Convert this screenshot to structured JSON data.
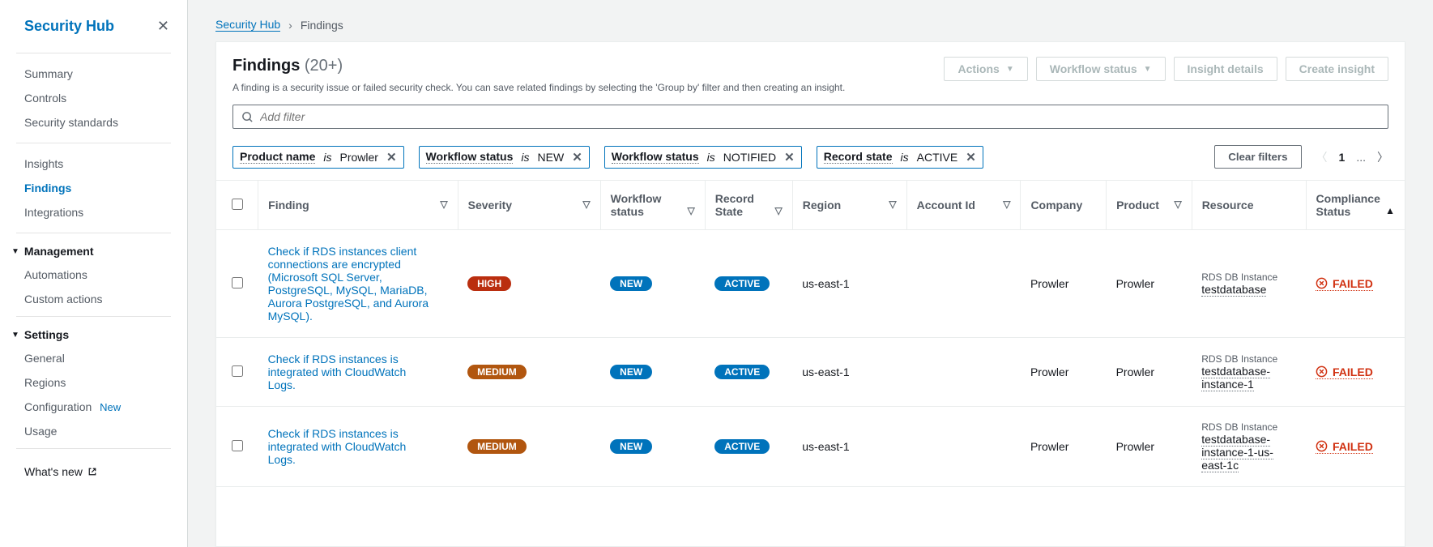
{
  "sidebar": {
    "title": "Security Hub",
    "sections": {
      "top": [
        "Summary",
        "Controls",
        "Security standards"
      ],
      "mid": [
        "Insights",
        "Findings",
        "Integrations"
      ],
      "management_label": "Management",
      "management": [
        "Automations",
        "Custom actions"
      ],
      "settings_label": "Settings",
      "settings": [
        "General",
        "Regions",
        "Configuration",
        "Usage"
      ]
    },
    "config_new": "New",
    "whats_new": "What's new"
  },
  "breadcrumb": {
    "root": "Security Hub",
    "current": "Findings"
  },
  "header": {
    "title": "Findings",
    "count": "(20+)",
    "desc": "A finding is a security issue or failed security check. You can save related findings by selecting the 'Group by' filter and then creating an insight.",
    "actions": "Actions",
    "workflow": "Workflow status",
    "insight_details": "Insight details",
    "create": "Create insight"
  },
  "filter": {
    "placeholder": "Add filter",
    "chips": [
      {
        "key": "Product name",
        "op": "is",
        "val": "Prowler"
      },
      {
        "key": "Workflow status",
        "op": "is",
        "val": "NEW"
      },
      {
        "key": "Workflow status",
        "op": "is",
        "val": "NOTIFIED"
      },
      {
        "key": "Record state",
        "op": "is",
        "val": "ACTIVE"
      }
    ],
    "clear": "Clear filters",
    "page": "1",
    "dots": "..."
  },
  "columns": {
    "finding": "Finding",
    "severity": "Severity",
    "workflow": "Workflow status",
    "record": "Record State",
    "region": "Region",
    "account": "Account Id",
    "company": "Company",
    "product": "Product",
    "resource": "Resource",
    "compliance": "Compliance Status"
  },
  "rows": [
    {
      "finding": "Check if RDS instances client connections are encrypted (Microsoft SQL Server, PostgreSQL, MySQL, MariaDB, Aurora PostgreSQL, and Aurora MySQL).",
      "severity": "HIGH",
      "workflow": "NEW",
      "record": "ACTIVE",
      "region": "us-east-1",
      "account": "",
      "company": "Prowler",
      "product": "Prowler",
      "resource_type": "RDS DB Instance",
      "resource_id": "testdatabase",
      "compliance": "FAILED"
    },
    {
      "finding": "Check if RDS instances is integrated with CloudWatch Logs.",
      "severity": "MEDIUM",
      "workflow": "NEW",
      "record": "ACTIVE",
      "region": "us-east-1",
      "account": "",
      "company": "Prowler",
      "product": "Prowler",
      "resource_type": "RDS DB Instance",
      "resource_id": "testdatabase-instance-1",
      "compliance": "FAILED"
    },
    {
      "finding": "Check if RDS instances is integrated with CloudWatch Logs.",
      "severity": "MEDIUM",
      "workflow": "NEW",
      "record": "ACTIVE",
      "region": "us-east-1",
      "account": "",
      "company": "Prowler",
      "product": "Prowler",
      "resource_type": "RDS DB Instance",
      "resource_id": "testdatabase-instance-1-us-east-1c",
      "compliance": "FAILED"
    }
  ]
}
